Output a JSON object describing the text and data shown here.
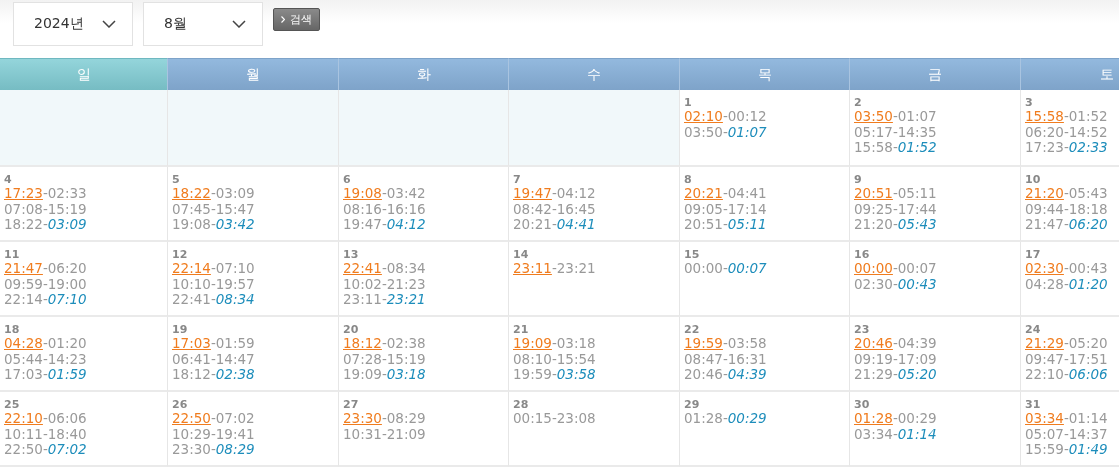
{
  "toolbar": {
    "year_select": {
      "value": "2024년"
    },
    "month_select": {
      "value": "8월"
    },
    "search_button": {
      "label": "검색"
    }
  },
  "weekdays": [
    {
      "label": "일",
      "selected": true
    },
    {
      "label": "월",
      "selected": false
    },
    {
      "label": "화",
      "selected": false
    },
    {
      "label": "수",
      "selected": false
    },
    {
      "label": "목",
      "selected": false
    },
    {
      "label": "금",
      "selected": false
    },
    {
      "label": "토",
      "selected": false
    }
  ],
  "weeks": [
    [
      {
        "kind": "blank"
      },
      {
        "kind": "blank"
      },
      {
        "kind": "blank"
      },
      {
        "kind": "blank"
      },
      {
        "kind": "day",
        "day": "1",
        "lines": [
          {
            "kind": "link",
            "a": "02:10",
            "b": "-00:12"
          },
          {
            "kind": "next",
            "a": "03:50-",
            "b": "01:07"
          }
        ]
      },
      {
        "kind": "day",
        "day": "2",
        "lines": [
          {
            "kind": "link",
            "a": "03:50",
            "b": "-01:07"
          },
          {
            "kind": "plain",
            "text": "05:17-14:35"
          },
          {
            "kind": "next",
            "a": "15:58-",
            "b": "01:52"
          }
        ]
      },
      {
        "kind": "day",
        "day": "3",
        "lines": [
          {
            "kind": "link",
            "a": "15:58",
            "b": "-01:52"
          },
          {
            "kind": "plain",
            "text": "06:20-14:52"
          },
          {
            "kind": "next",
            "a": "17:23-",
            "b": "02:33"
          }
        ]
      }
    ],
    [
      {
        "kind": "day",
        "day": "4",
        "lines": [
          {
            "kind": "link",
            "a": "17:23",
            "b": "-02:33"
          },
          {
            "kind": "plain",
            "text": "07:08-15:19"
          },
          {
            "kind": "next",
            "a": "18:22-",
            "b": "03:09"
          }
        ]
      },
      {
        "kind": "day",
        "day": "5",
        "lines": [
          {
            "kind": "link",
            "a": "18:22",
            "b": "-03:09"
          },
          {
            "kind": "plain",
            "text": "07:45-15:47"
          },
          {
            "kind": "next",
            "a": "19:08-",
            "b": "03:42"
          }
        ]
      },
      {
        "kind": "day",
        "day": "6",
        "lines": [
          {
            "kind": "link",
            "a": "19:08",
            "b": "-03:42"
          },
          {
            "kind": "plain",
            "text": "08:16-16:16"
          },
          {
            "kind": "next",
            "a": "19:47-",
            "b": "04:12"
          }
        ]
      },
      {
        "kind": "day",
        "day": "7",
        "lines": [
          {
            "kind": "link",
            "a": "19:47",
            "b": "-04:12"
          },
          {
            "kind": "plain",
            "text": "08:42-16:45"
          },
          {
            "kind": "next",
            "a": "20:21-",
            "b": "04:41"
          }
        ]
      },
      {
        "kind": "day",
        "day": "8",
        "lines": [
          {
            "kind": "link",
            "a": "20:21",
            "b": "-04:41"
          },
          {
            "kind": "plain",
            "text": "09:05-17:14"
          },
          {
            "kind": "next",
            "a": "20:51-",
            "b": "05:11"
          }
        ]
      },
      {
        "kind": "day",
        "day": "9",
        "lines": [
          {
            "kind": "link",
            "a": "20:51",
            "b": "-05:11"
          },
          {
            "kind": "plain",
            "text": "09:25-17:44"
          },
          {
            "kind": "next",
            "a": "21:20-",
            "b": "05:43"
          }
        ]
      },
      {
        "kind": "day",
        "day": "10",
        "lines": [
          {
            "kind": "link",
            "a": "21:20",
            "b": "-05:43"
          },
          {
            "kind": "plain",
            "text": "09:44-18:18"
          },
          {
            "kind": "next",
            "a": "21:47-",
            "b": "06:20"
          }
        ]
      }
    ],
    [
      {
        "kind": "day",
        "day": "11",
        "lines": [
          {
            "kind": "link",
            "a": "21:47",
            "b": "-06:20"
          },
          {
            "kind": "plain",
            "text": "09:59-19:00"
          },
          {
            "kind": "next",
            "a": "22:14-",
            "b": "07:10"
          }
        ]
      },
      {
        "kind": "day",
        "day": "12",
        "lines": [
          {
            "kind": "link",
            "a": "22:14",
            "b": "-07:10"
          },
          {
            "kind": "plain",
            "text": "10:10-19:57"
          },
          {
            "kind": "next",
            "a": "22:41-",
            "b": "08:34"
          }
        ]
      },
      {
        "kind": "day",
        "day": "13",
        "lines": [
          {
            "kind": "link",
            "a": "22:41",
            "b": "-08:34"
          },
          {
            "kind": "plain",
            "text": "10:02-21:23"
          },
          {
            "kind": "next",
            "a": "23:11-",
            "b": "23:21"
          }
        ]
      },
      {
        "kind": "day",
        "day": "14",
        "lines": [
          {
            "kind": "link",
            "a": "23:11",
            "b": "-23:21"
          }
        ]
      },
      {
        "kind": "day",
        "day": "15",
        "lines": [
          {
            "kind": "next",
            "a": "00:00-",
            "b": "00:07"
          }
        ]
      },
      {
        "kind": "day",
        "day": "16",
        "lines": [
          {
            "kind": "link",
            "a": "00:00",
            "b": "-00:07"
          },
          {
            "kind": "next",
            "a": "02:30-",
            "b": "00:43"
          }
        ]
      },
      {
        "kind": "day",
        "day": "17",
        "lines": [
          {
            "kind": "link",
            "a": "02:30",
            "b": "-00:43"
          },
          {
            "kind": "next",
            "a": "04:28-",
            "b": "01:20"
          }
        ]
      }
    ],
    [
      {
        "kind": "day",
        "day": "18",
        "lines": [
          {
            "kind": "link",
            "a": "04:28",
            "b": "-01:20"
          },
          {
            "kind": "plain",
            "text": "05:44-14:23"
          },
          {
            "kind": "next",
            "a": "17:03-",
            "b": "01:59"
          }
        ]
      },
      {
        "kind": "day",
        "day": "19",
        "lines": [
          {
            "kind": "link",
            "a": "17:03",
            "b": "-01:59"
          },
          {
            "kind": "plain",
            "text": "06:41-14:47"
          },
          {
            "kind": "next",
            "a": "18:12-",
            "b": "02:38"
          }
        ]
      },
      {
        "kind": "day",
        "day": "20",
        "lines": [
          {
            "kind": "link",
            "a": "18:12",
            "b": "-02:38"
          },
          {
            "kind": "plain",
            "text": "07:28-15:19"
          },
          {
            "kind": "next",
            "a": "19:09-",
            "b": "03:18"
          }
        ]
      },
      {
        "kind": "day",
        "day": "21",
        "lines": [
          {
            "kind": "link",
            "a": "19:09",
            "b": "-03:18"
          },
          {
            "kind": "plain",
            "text": "08:10-15:54"
          },
          {
            "kind": "next",
            "a": "19:59-",
            "b": "03:58"
          }
        ]
      },
      {
        "kind": "day",
        "day": "22",
        "lines": [
          {
            "kind": "link",
            "a": "19:59",
            "b": "-03:58"
          },
          {
            "kind": "plain",
            "text": "08:47-16:31"
          },
          {
            "kind": "next",
            "a": "20:46-",
            "b": "04:39"
          }
        ]
      },
      {
        "kind": "day",
        "day": "23",
        "lines": [
          {
            "kind": "link",
            "a": "20:46",
            "b": "-04:39"
          },
          {
            "kind": "plain",
            "text": "09:19-17:09"
          },
          {
            "kind": "next",
            "a": "21:29-",
            "b": "05:20"
          }
        ]
      },
      {
        "kind": "day",
        "day": "24",
        "lines": [
          {
            "kind": "link",
            "a": "21:29",
            "b": "-05:20"
          },
          {
            "kind": "plain",
            "text": "09:47-17:51"
          },
          {
            "kind": "next",
            "a": "22:10-",
            "b": "06:06"
          }
        ]
      }
    ],
    [
      {
        "kind": "day",
        "day": "25",
        "lines": [
          {
            "kind": "link",
            "a": "22:10",
            "b": "-06:06"
          },
          {
            "kind": "plain",
            "text": "10:11-18:40"
          },
          {
            "kind": "next",
            "a": "22:50-",
            "b": "07:02"
          }
        ]
      },
      {
        "kind": "day",
        "day": "26",
        "lines": [
          {
            "kind": "link",
            "a": "22:50",
            "b": "-07:02"
          },
          {
            "kind": "plain",
            "text": "10:29-19:41"
          },
          {
            "kind": "next",
            "a": "23:30-",
            "b": "08:29"
          }
        ]
      },
      {
        "kind": "day",
        "day": "27",
        "lines": [
          {
            "kind": "link",
            "a": "23:30",
            "b": "-08:29"
          },
          {
            "kind": "plain",
            "text": "10:31-21:09"
          }
        ]
      },
      {
        "kind": "day",
        "day": "28",
        "lines": [
          {
            "kind": "plain",
            "text": "00:15-23:08"
          }
        ]
      },
      {
        "kind": "day",
        "day": "29",
        "lines": [
          {
            "kind": "next",
            "a": "01:28-",
            "b": "00:29"
          }
        ]
      },
      {
        "kind": "day",
        "day": "30",
        "lines": [
          {
            "kind": "link",
            "a": "01:28",
            "b": "-00:29"
          },
          {
            "kind": "next",
            "a": "03:34-",
            "b": "01:14"
          }
        ]
      },
      {
        "kind": "day",
        "day": "31",
        "lines": [
          {
            "kind": "link",
            "a": "03:34",
            "b": "-01:14"
          },
          {
            "kind": "plain",
            "text": "05:07-14:37"
          },
          {
            "kind": "next",
            "a": "15:59-",
            "b": "01:49"
          }
        ]
      }
    ]
  ]
}
